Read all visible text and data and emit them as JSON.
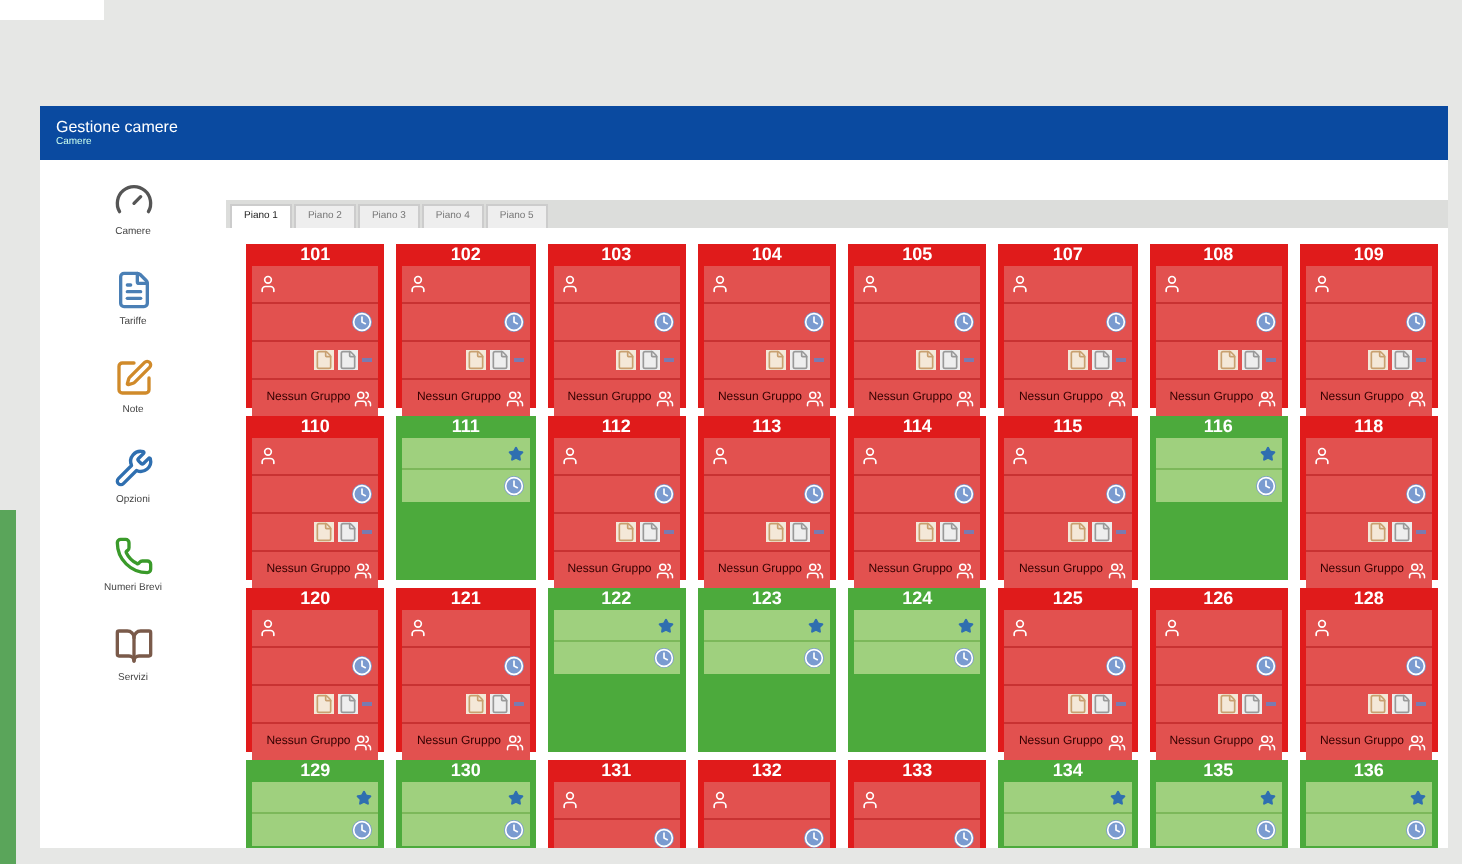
{
  "window": {
    "title": "Gestione camere",
    "subtitle": "Camere"
  },
  "sidebar": {
    "items": [
      {
        "label": "Camere"
      },
      {
        "label": "Tariffe"
      },
      {
        "label": "Note"
      },
      {
        "label": "Opzioni"
      },
      {
        "label": "Numeri Brevi"
      },
      {
        "label": "Servizi"
      }
    ]
  },
  "tabs": [
    {
      "label": "Piano 1",
      "selected": true
    },
    {
      "label": "Piano 2",
      "selected": false
    },
    {
      "label": "Piano 3",
      "selected": false
    },
    {
      "label": "Piano 4",
      "selected": false
    },
    {
      "label": "Piano 5",
      "selected": false
    }
  ],
  "rooms": [
    {
      "number": "101",
      "kind": "occupied",
      "group": "Nessun Gruppo"
    },
    {
      "number": "102",
      "kind": "occupied",
      "group": "Nessun Gruppo"
    },
    {
      "number": "103",
      "kind": "occupied",
      "group": "Nessun Gruppo"
    },
    {
      "number": "104",
      "kind": "occupied",
      "group": "Nessun Gruppo"
    },
    {
      "number": "105",
      "kind": "occupied",
      "group": "Nessun Gruppo"
    },
    {
      "number": "107",
      "kind": "occupied",
      "group": "Nessun Gruppo"
    },
    {
      "number": "108",
      "kind": "occupied",
      "group": "Nessun Gruppo"
    },
    {
      "number": "109",
      "kind": "occupied",
      "group": "Nessun Gruppo"
    },
    {
      "number": "110",
      "kind": "occupied",
      "group": "Nessun Gruppo"
    },
    {
      "number": "111",
      "kind": "free"
    },
    {
      "number": "112",
      "kind": "occupied",
      "group": "Nessun Gruppo"
    },
    {
      "number": "113",
      "kind": "occupied",
      "group": "Nessun Gruppo"
    },
    {
      "number": "114",
      "kind": "occupied",
      "group": "Nessun Gruppo"
    },
    {
      "number": "115",
      "kind": "occupied",
      "group": "Nessun Gruppo"
    },
    {
      "number": "116",
      "kind": "free"
    },
    {
      "number": "118",
      "kind": "occupied",
      "group": "Nessun Gruppo"
    },
    {
      "number": "120",
      "kind": "occupied",
      "group": "Nessun Gruppo"
    },
    {
      "number": "121",
      "kind": "occupied",
      "group": "Nessun Gruppo"
    },
    {
      "number": "122",
      "kind": "free"
    },
    {
      "number": "123",
      "kind": "free"
    },
    {
      "number": "124",
      "kind": "free"
    },
    {
      "number": "125",
      "kind": "occupied",
      "group": "Nessun Gruppo"
    },
    {
      "number": "126",
      "kind": "occupied",
      "group": "Nessun Gruppo"
    },
    {
      "number": "128",
      "kind": "occupied",
      "group": "Nessun Gruppo"
    },
    {
      "number": "129",
      "kind": "free"
    },
    {
      "number": "130",
      "kind": "free"
    },
    {
      "number": "131",
      "kind": "occupied"
    },
    {
      "number": "132",
      "kind": "occupied"
    },
    {
      "number": "133",
      "kind": "occupied"
    },
    {
      "number": "134",
      "kind": "free"
    },
    {
      "number": "135",
      "kind": "free"
    },
    {
      "number": "136",
      "kind": "free"
    }
  ]
}
